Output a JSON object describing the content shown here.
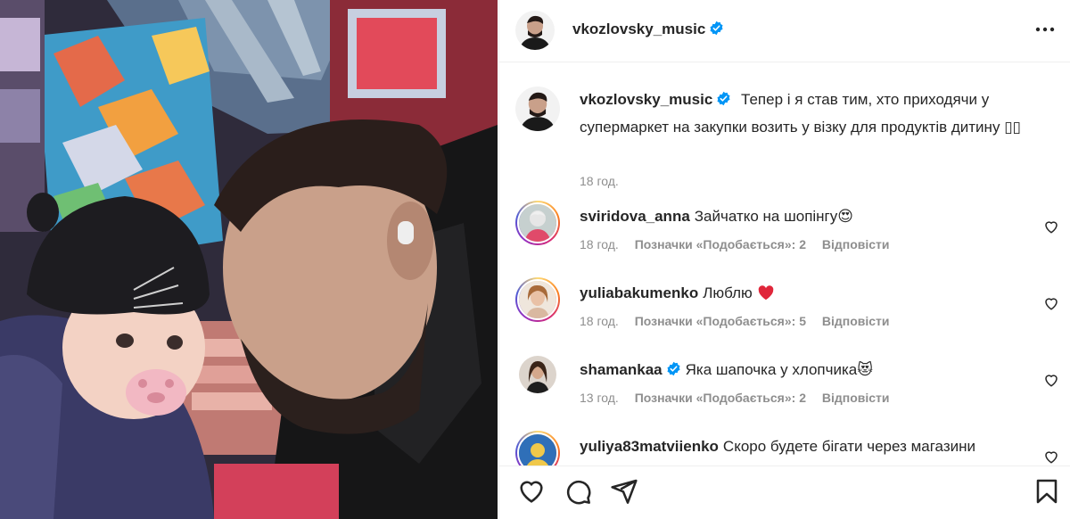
{
  "post": {
    "username": "vkozlovsky_music",
    "verified": true,
    "more_icon": "more-horizontal-icon",
    "caption": "Тепер і я став тим, хто приходячи у супермаркет на закупки возить у візку для продуктів дитину",
    "caption_emoji": "▯▯",
    "time": "18 год."
  },
  "comments": [
    {
      "username": "sviridova_anna",
      "verified": false,
      "text": "Зайчатко на шопінгу",
      "emoji": "😍",
      "time": "18 год.",
      "likes": "Позначки «Подобається»: 2",
      "reply": "Відповісти"
    },
    {
      "username": "yuliabakumenko",
      "verified": false,
      "text": "Люблю",
      "emoji": "❤️",
      "time": "18 год.",
      "likes": "Позначки «Подобається»: 5",
      "reply": "Відповісти"
    },
    {
      "username": "shamankaa",
      "verified": true,
      "text": "Яка шапочка у хлопчика",
      "emoji": "😻",
      "time": "13 год.",
      "likes": "Позначки «Подобається»: 2",
      "reply": "Відповісти"
    },
    {
      "username": "yuliya83matviienko",
      "verified": false,
      "text": "Скоро будете бігати через магазини",
      "emoji": "",
      "time": "",
      "likes": "",
      "reply": ""
    }
  ],
  "actions": [
    "heart-icon",
    "comment-icon",
    "share-icon",
    "bookmark-icon"
  ],
  "colors": {
    "verified": "#0095f6",
    "muted": "#8e8e8e",
    "text": "#262626",
    "heart": "#ed4956"
  }
}
